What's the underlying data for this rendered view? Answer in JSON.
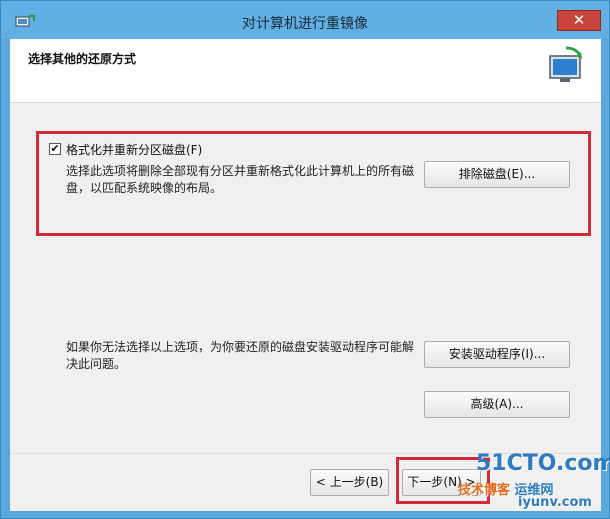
{
  "window": {
    "title": "对计算机进行重镜像",
    "close_label": "✕"
  },
  "header": {
    "title": "选择其他的还原方式",
    "icon": "computer-restore-icon"
  },
  "option": {
    "checkbox_label": "格式化并重新分区磁盘(F)",
    "checked": true,
    "description": "选择此选项将删除全部现有分区并重新格式化此计算机上的所有磁盘，以匹配系统映像的布局。",
    "exclude_button": "排除磁盘(E)..."
  },
  "drivers": {
    "text": "如果你无法选择以上选项，为你要还原的磁盘安装驱动程序可能解决此问题。",
    "install_button": "安装驱动程序(I)...",
    "advanced_button": "高级(A)..."
  },
  "footer": {
    "prev_button": "< 上一步(B)",
    "next_button": "下一步(N) >"
  },
  "watermark": {
    "main": "51CTO.com",
    "sub": "技术博客",
    "sub2": "运维网",
    "sub3": "iyunv.com"
  },
  "colors": {
    "highlight": "#d42a37",
    "titlebar": "#62b0e3",
    "close": "#c9453a"
  }
}
